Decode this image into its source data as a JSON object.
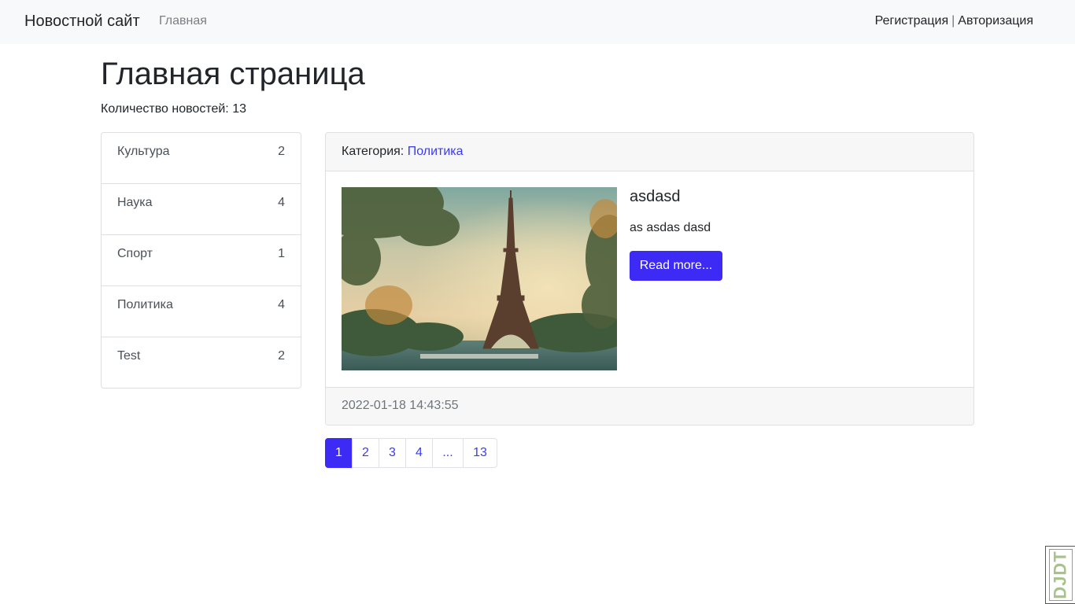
{
  "navbar": {
    "brand": "Новостной сайт",
    "home": "Главная",
    "register": "Регистрация",
    "separator": "|",
    "login": "Авторизация"
  },
  "main": {
    "title": "Главная страница",
    "news_count": "Количество новостей: 13"
  },
  "categories": [
    {
      "name": "Культура",
      "count": "2"
    },
    {
      "name": "Наука",
      "count": "4"
    },
    {
      "name": "Спорт",
      "count": "1"
    },
    {
      "name": "Политика",
      "count": "4"
    },
    {
      "name": "Test",
      "count": "2"
    }
  ],
  "news_card": {
    "category_label": "Категория:",
    "category": "Политика",
    "title": "asdasd",
    "text": "as asdas dasd",
    "read_more": "Read more...",
    "date": "2022-01-18 14:43:55",
    "image": "eiffel-tower-photo"
  },
  "pagination": [
    "1",
    "2",
    "3",
    "4",
    "...",
    "13"
  ],
  "debug_toolbar": {
    "label": "DJDT"
  },
  "colors": {
    "accent": "#3d2bf5",
    "link": "#3a3bf0",
    "navbar_bg": "#f8f9fa"
  }
}
